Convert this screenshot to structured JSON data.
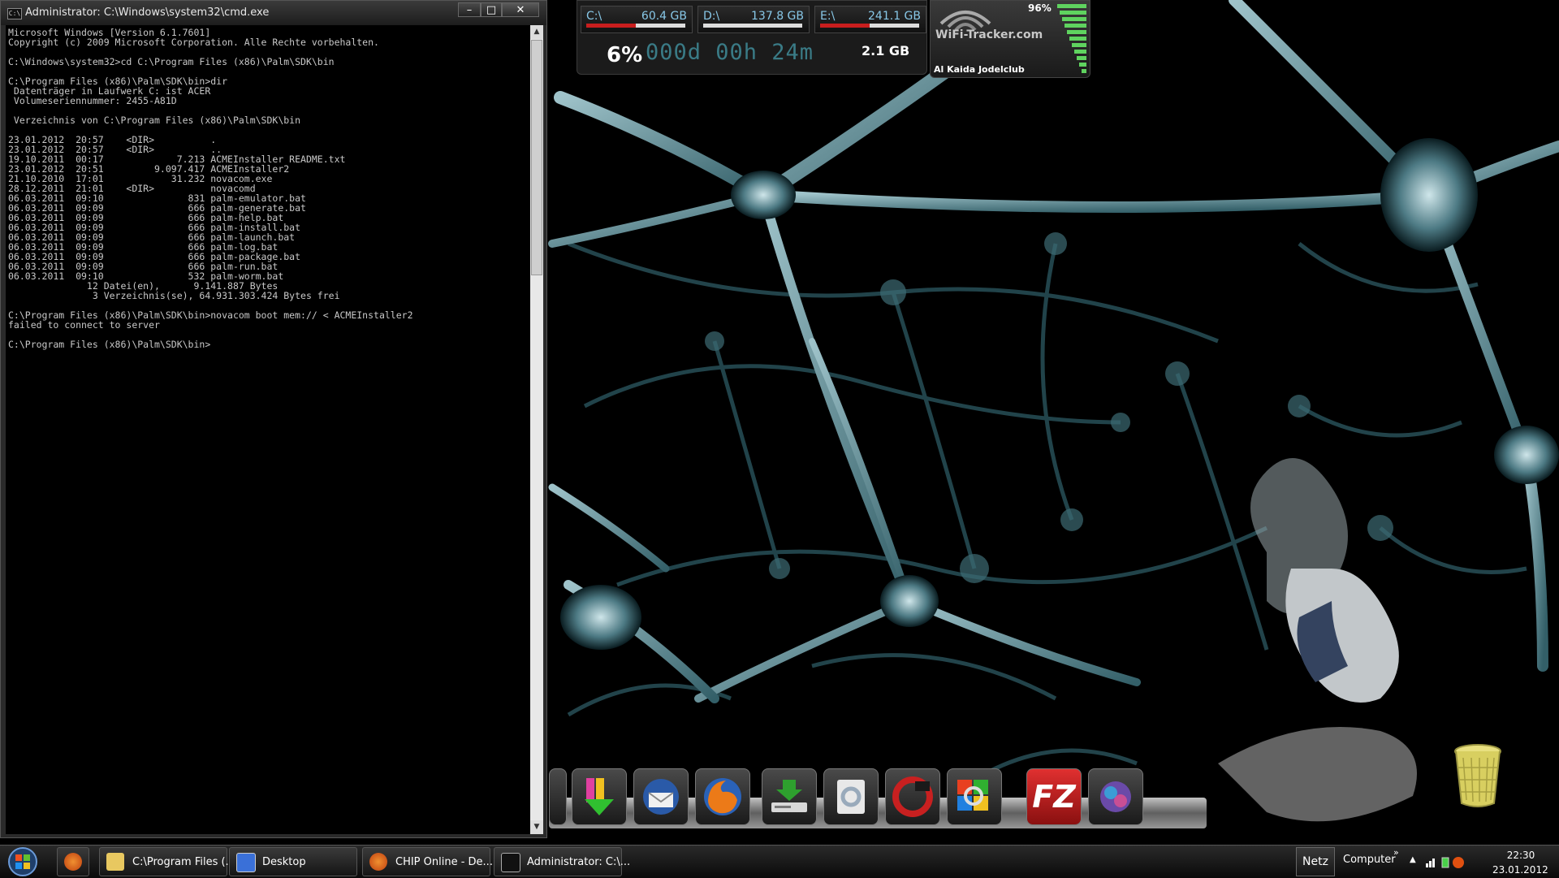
{
  "cmd": {
    "title": "Administrator: C:\\Windows\\system32\\cmd.exe",
    "icon": "C:\\",
    "min": "–",
    "max": "□",
    "close": "✕",
    "output": "Microsoft Windows [Version 6.1.7601]\nCopyright (c) 2009 Microsoft Corporation. Alle Rechte vorbehalten.\n\nC:\\Windows\\system32>cd C:\\Program Files (x86)\\Palm\\SDK\\bin\n\nC:\\Program Files (x86)\\Palm\\SDK\\bin>dir\n Datenträger in Laufwerk C: ist ACER\n Volumeseriennummer: 2455-A81D\n\n Verzeichnis von C:\\Program Files (x86)\\Palm\\SDK\\bin\n\n23.01.2012  20:57    <DIR>          .\n23.01.2012  20:57    <DIR>          ..\n19.10.2011  00:17             7.213 ACMEInstaller README.txt\n23.01.2012  20:51         9.097.417 ACMEInstaller2\n21.10.2010  17:01            31.232 novacom.exe\n28.12.2011  21:01    <DIR>          novacomd\n06.03.2011  09:10               831 palm-emulator.bat\n06.03.2011  09:09               666 palm-generate.bat\n06.03.2011  09:09               666 palm-help.bat\n06.03.2011  09:09               666 palm-install.bat\n06.03.2011  09:09               666 palm-launch.bat\n06.03.2011  09:09               666 palm-log.bat\n06.03.2011  09:09               666 palm-package.bat\n06.03.2011  09:09               666 palm-run.bat\n06.03.2011  09:10               532 palm-worm.bat\n              12 Datei(en),      9.141.887 Bytes\n               3 Verzeichnis(se), 64.931.303.424 Bytes frei\n\nC:\\Program Files (x86)\\Palm\\SDK\\bin>novacom boot mem:// < ACMEInstaller2\nfailed to connect to server\n\nC:\\Program Files (x86)\\Palm\\SDK\\bin>"
  },
  "drives": [
    {
      "letter": "C:\\",
      "size": "60.4 GB",
      "fill": 0.5
    },
    {
      "letter": "D:\\",
      "size": "137.8 GB",
      "fill": 0.0
    },
    {
      "letter": "E:\\",
      "size": "241.1 GB",
      "fill": 0.5
    }
  ],
  "system": {
    "cpu": "6%",
    "uptime": "000d 00h 24m",
    "ram": "2.1 GB"
  },
  "wifi": {
    "brand": "WiFi-Tracker.com",
    "signal": "96%",
    "network": "Al Kaida Jodelclub"
  },
  "dock": {
    "icons": [
      "download-arrow-icon",
      "thunderbird-icon",
      "firefox-icon",
      "network-drive-icon",
      "settings-icon",
      "ccleaner-icon",
      "search-globe-icon",
      "filezilla-icon",
      "apple-orb-icon"
    ],
    "filezilla_label": "FZ"
  },
  "taskbar": {
    "items": [
      {
        "label": "C:\\Program Files (..."
      },
      {
        "label": "Desktop"
      },
      {
        "label": "CHIP Online - De..."
      },
      {
        "label": "Administrator: C:\\..."
      }
    ],
    "tray_netz": "Netz",
    "tray_computer": "Computer",
    "tray_chevron": "»",
    "tray_up": "▲",
    "time": "22:30",
    "date": "23.01.2012"
  }
}
